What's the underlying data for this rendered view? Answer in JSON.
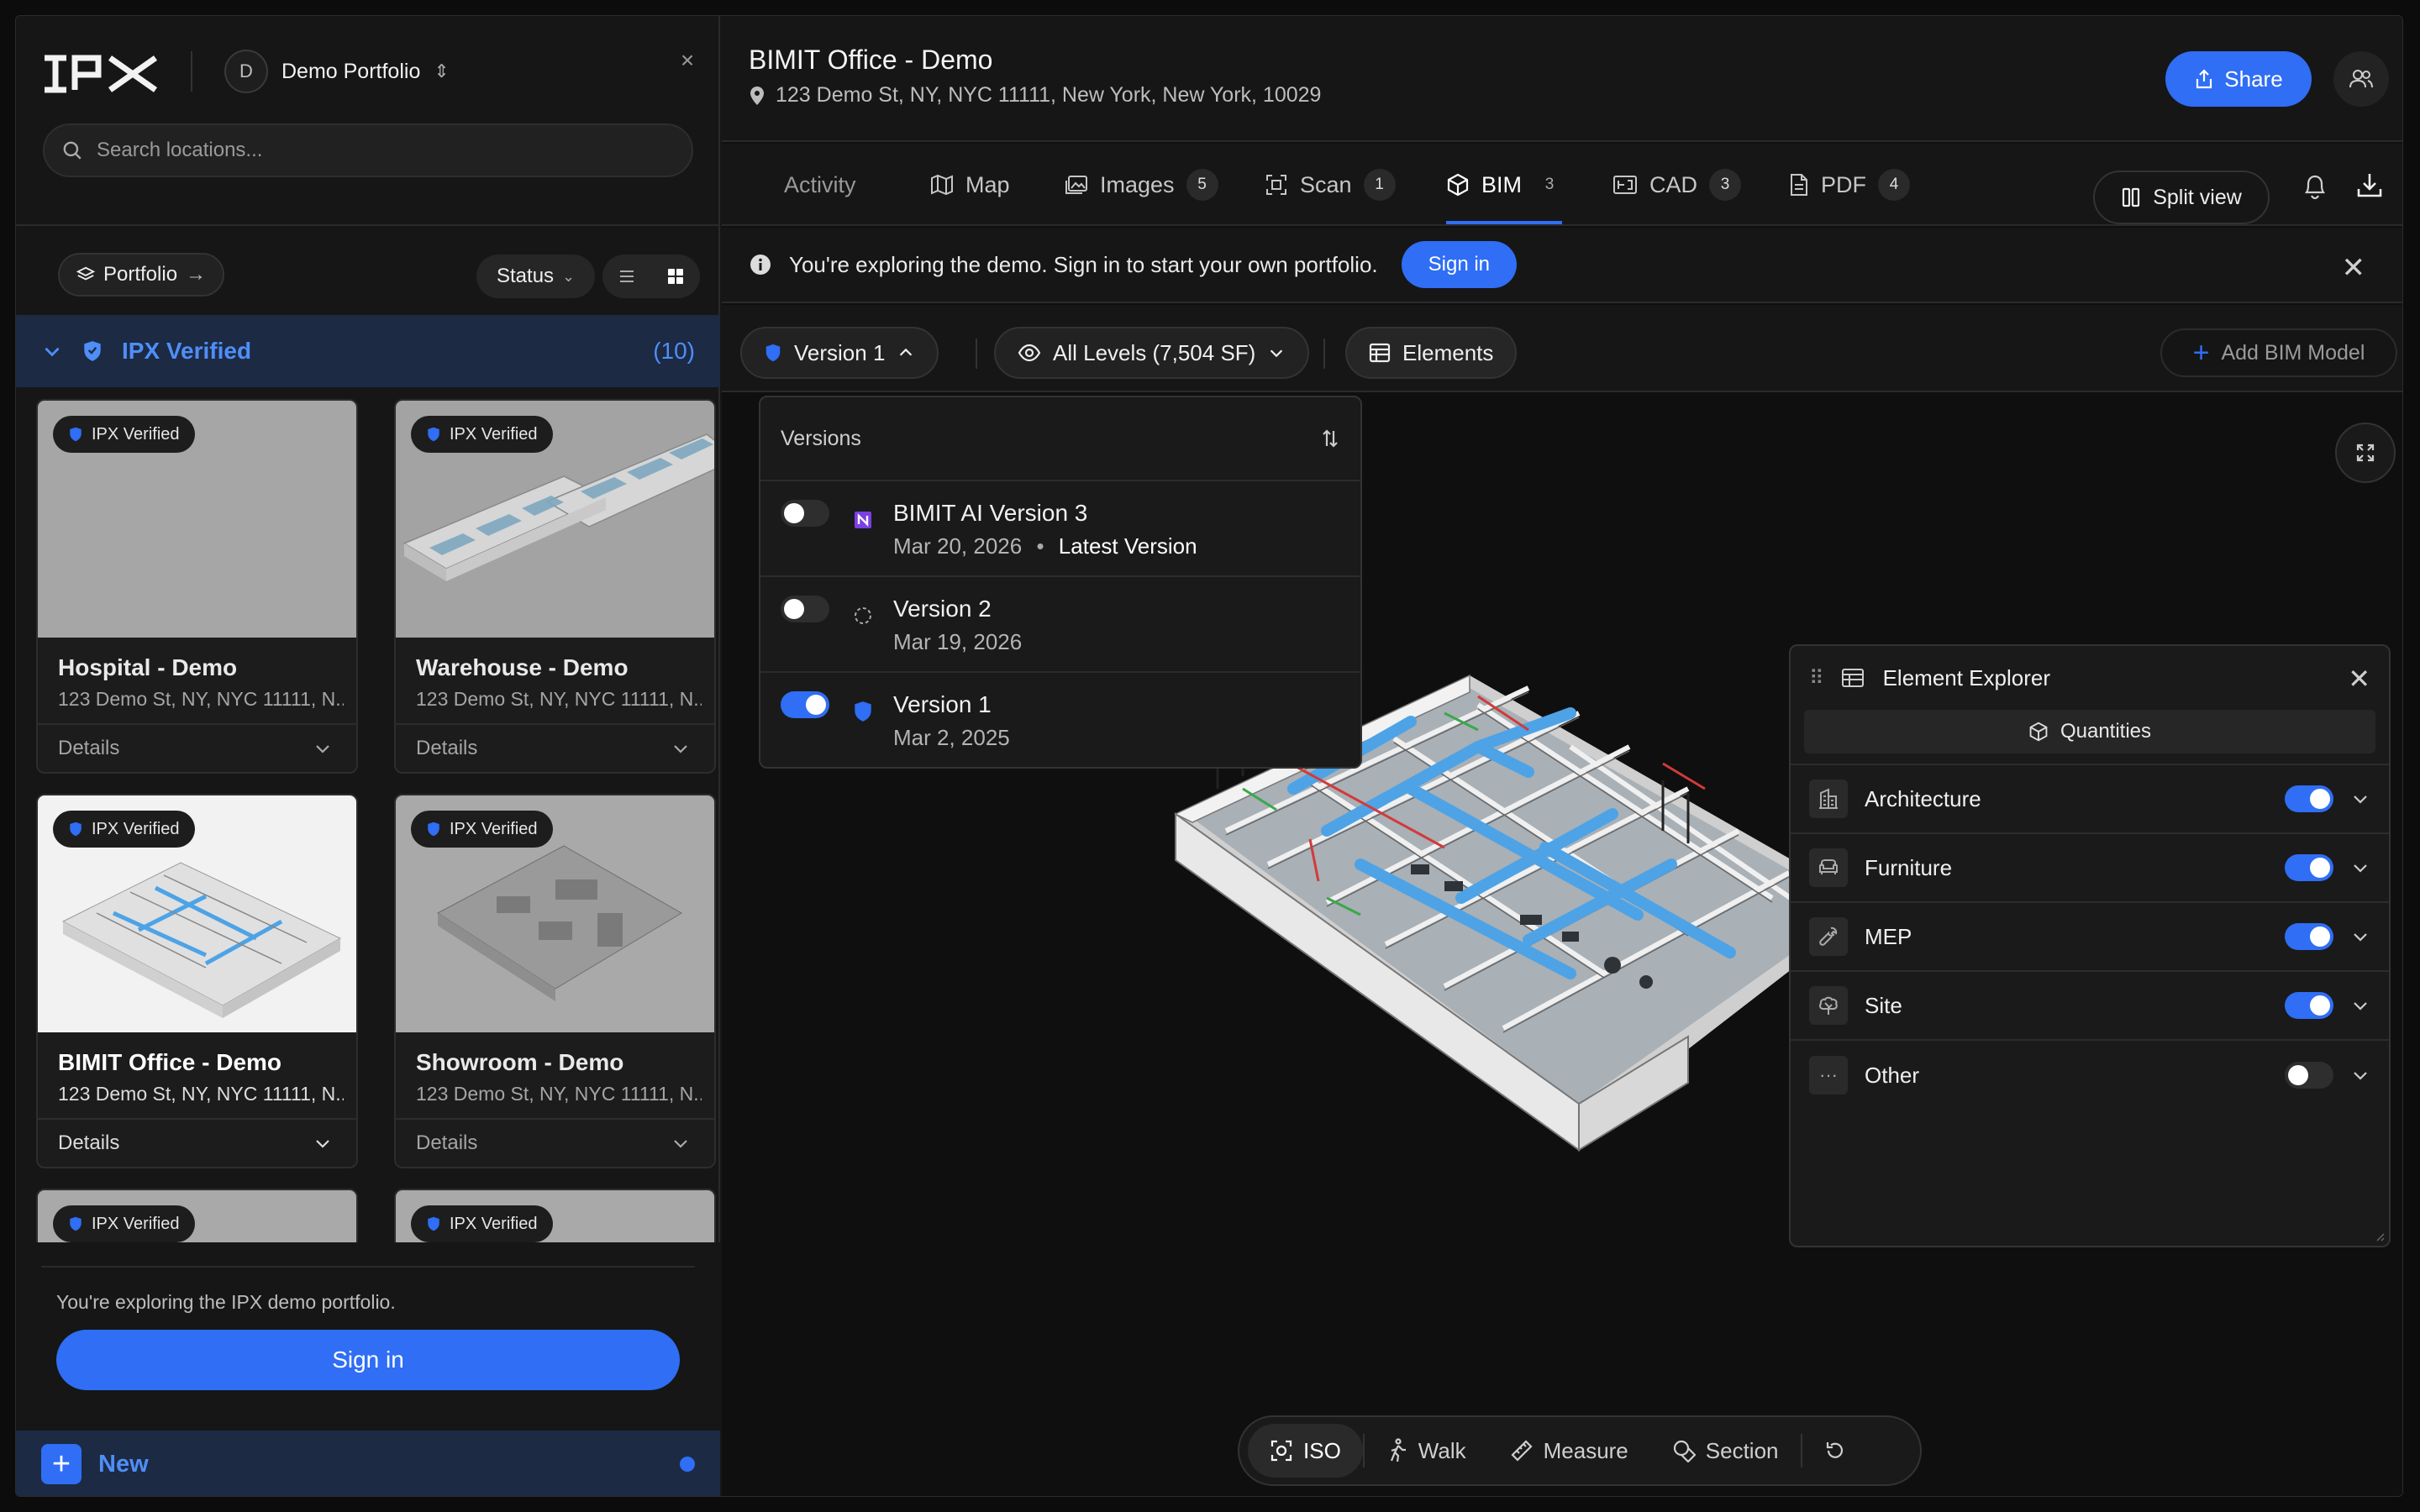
{
  "colors": {
    "accent": "#2f6ef5",
    "accent_text": "#4f8ef7",
    "bg": "#161616",
    "ducts": "#4da3e6"
  },
  "sidebar": {
    "logo": "IPX",
    "portfolio_initial": "D",
    "portfolio_name": "Demo Portfolio",
    "search_placeholder": "Search locations...",
    "portfolio_pill": "Portfolio",
    "status_filter": "Status",
    "group_title": "IPX Verified",
    "group_count": "(10)",
    "cards": [
      {
        "badge": "IPX Verified",
        "title": "Hospital - Demo",
        "address": "123 Demo St, NY, NYC 11111, N...",
        "details": "Details"
      },
      {
        "badge": "IPX Verified",
        "title": "Warehouse - Demo",
        "address": "123 Demo St, NY, NYC 11111, N...",
        "details": "Details"
      },
      {
        "badge": "IPX Verified",
        "title": "BIMIT Office - Demo",
        "address": "123 Demo St, NY, NYC 11111, N...",
        "details": "Details"
      },
      {
        "badge": "IPX Verified",
        "title": "Showroom - Demo",
        "address": "123 Demo St, NY, NYC 11111, N...",
        "details": "Details"
      },
      {
        "badge": "IPX Verified"
      },
      {
        "badge": "IPX Verified"
      }
    ],
    "demo_note": "You're exploring the IPX demo portfolio.",
    "signin": "Sign in",
    "new": "New"
  },
  "header": {
    "title": "BIMIT Office - Demo",
    "address": "123 Demo St, NY, NYC 11111, New York, New York, 10029",
    "share": "Share"
  },
  "tabs": [
    {
      "label": "Activity",
      "icon": "activity"
    },
    {
      "label": "Map",
      "icon": "map-icon"
    },
    {
      "label": "Images",
      "count": "5",
      "icon": "images-icon"
    },
    {
      "label": "Scan",
      "count": "1",
      "icon": "scan-icon"
    },
    {
      "label": "BIM",
      "count": "3",
      "icon": "cube-icon"
    },
    {
      "label": "CAD",
      "count": "3",
      "icon": "cad-icon"
    },
    {
      "label": "PDF",
      "count": "4",
      "icon": "pdf-icon"
    }
  ],
  "split_view": "Split view",
  "banner": {
    "text": "You're exploring the demo. Sign in to start your own portfolio.",
    "signin": "Sign in"
  },
  "toolbar": {
    "version": "Version 1",
    "levels": "All Levels (7,504 SF)",
    "elements": "Elements",
    "add_bim": "Add BIM Model"
  },
  "versions": {
    "title": "Versions",
    "items": [
      {
        "name": "BIMIT AI Version 3",
        "date": "Mar 20, 2026",
        "tag": "Latest Version",
        "on": false
      },
      {
        "name": "Version 2",
        "date": "Mar 19, 2026",
        "on": false
      },
      {
        "name": "Version 1",
        "date": "Mar 2, 2025",
        "on": true
      }
    ]
  },
  "explorer": {
    "title": "Element Explorer",
    "quantities": "Quantities",
    "rows": [
      {
        "label": "Architecture",
        "on": true
      },
      {
        "label": "Furniture",
        "on": true
      },
      {
        "label": "MEP",
        "on": true
      },
      {
        "label": "Site",
        "on": true
      },
      {
        "label": "Other",
        "on": false
      }
    ]
  },
  "tools": {
    "iso": "ISO",
    "walk": "Walk",
    "measure": "Measure",
    "section": "Section"
  }
}
